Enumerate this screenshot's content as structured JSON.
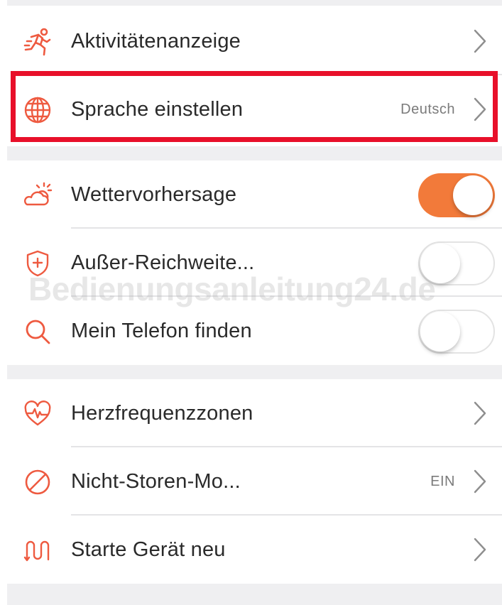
{
  "accent_color": "#f27a3a",
  "highlight_color": "#e8102a",
  "icon_color": "#ee5a40",
  "watermark": "Bedienungsanleitung24.de",
  "sections": [
    {
      "items": [
        {
          "label": "Aktivitätenanzeige",
          "icon": "running-person-icon",
          "control": "chevron"
        },
        {
          "label": "Sprache einstellen",
          "icon": "globe-icon",
          "value": "Deutsch",
          "control": "chevron",
          "highlighted": true
        }
      ]
    },
    {
      "items": [
        {
          "label": "Wettervorhersage",
          "icon": "weather-cloud-sun-icon",
          "control": "toggle",
          "enabled": true
        },
        {
          "label": "Außer-Reichweite...",
          "icon": "shield-plus-icon",
          "control": "toggle",
          "enabled": false
        },
        {
          "label": "Mein Telefon finden",
          "icon": "search-icon",
          "control": "toggle",
          "enabled": false
        }
      ]
    },
    {
      "items": [
        {
          "label": "Herzfrequenzzonen",
          "icon": "heart-rate-icon",
          "control": "chevron"
        },
        {
          "label": "Nicht-Storen-Mo...",
          "icon": "do-not-disturb-icon",
          "value": "EIN",
          "control": "chevron"
        },
        {
          "label": "Starte Gerät neu",
          "icon": "restart-icon",
          "control": "chevron"
        }
      ]
    }
  ]
}
